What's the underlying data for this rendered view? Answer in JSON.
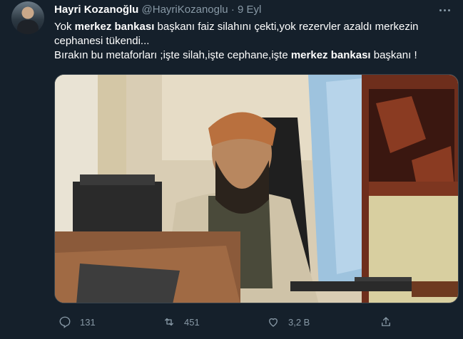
{
  "author": {
    "name": "Hayri Kozanoğlu",
    "handle": "@HayriKozanoglu",
    "separator": "·",
    "date": "9 Eyl"
  },
  "tweet": {
    "line1_pre": "Yok ",
    "line1_bold": "merkez bankası",
    "line1_post": " başkanı faiz silahını çekti,yok rezervler azaldı merkezin cephanesi tükendi...",
    "line2_pre": "Bırakın bu metaforları ;işte silah,işte cephane,işte ",
    "line2_bold": "merkez bankası",
    "line2_post": " başkanı !"
  },
  "actions": {
    "replies": "131",
    "retweets": "451",
    "likes": "3,2 B"
  },
  "icons": [
    "more-icon",
    "reply-icon",
    "retweet-icon",
    "like-icon",
    "share-icon"
  ],
  "colors": {
    "background": "#15202b",
    "text": "#ffffff",
    "secondary": "#8899a6",
    "border": "#38444d"
  }
}
